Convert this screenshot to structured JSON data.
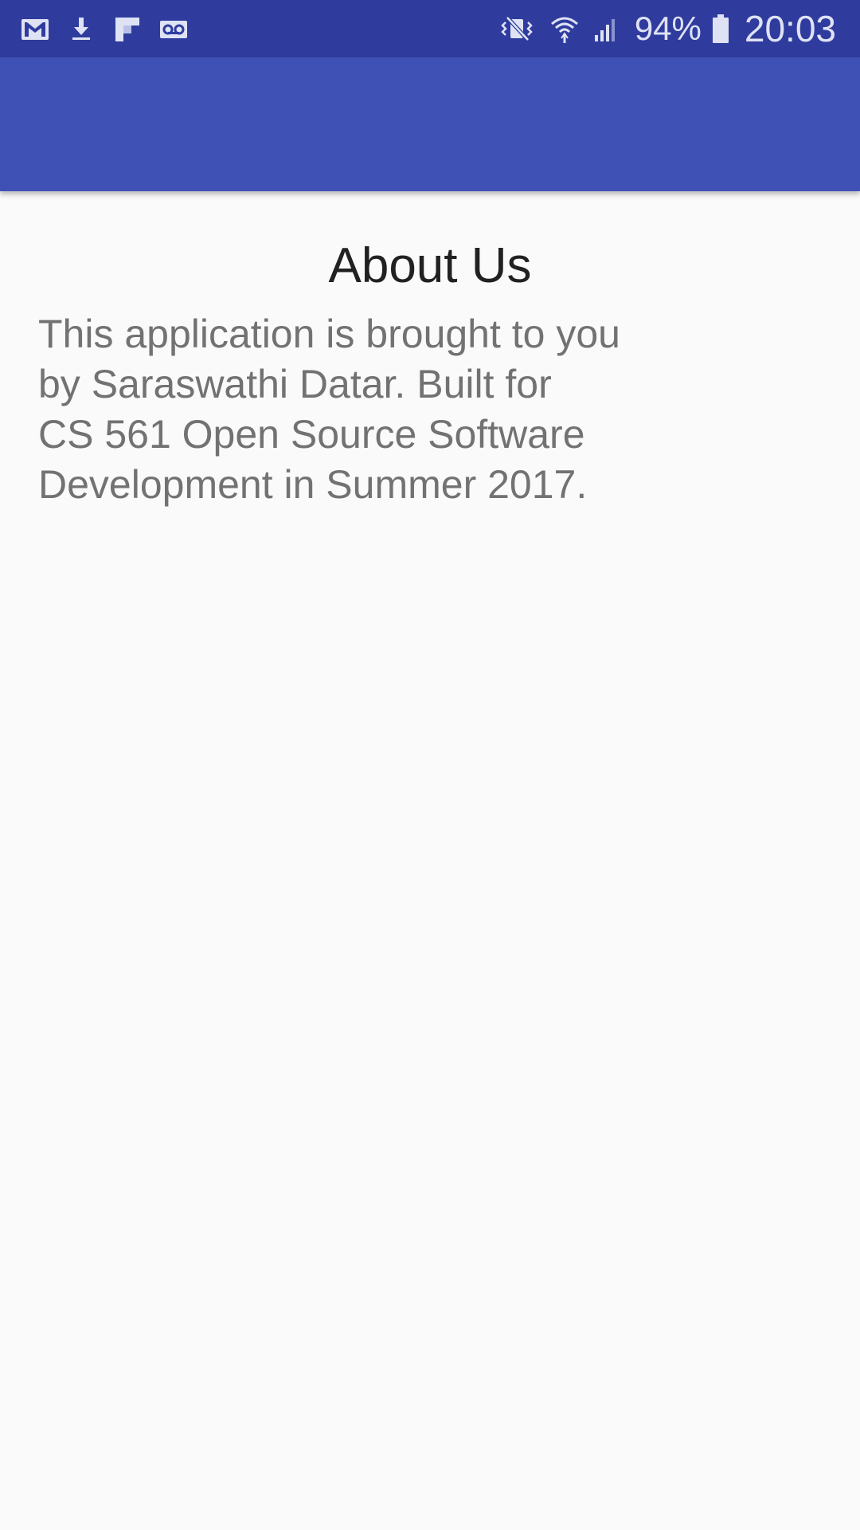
{
  "status_bar": {
    "left_icons": [
      "gmail-icon",
      "download-icon",
      "flipboard-icon",
      "voicemail-icon"
    ],
    "right_icons": [
      "vibrate-mute-icon",
      "wifi-icon",
      "cell-signal-icon",
      "battery-icon"
    ],
    "battery_percent": "94%",
    "time": "20:03",
    "background_color": "#2f3c9e"
  },
  "app_bar": {
    "background_color": "#3f51b5"
  },
  "main": {
    "title": "About Us",
    "body": "This application is brought to you\nby Saraswathi Datar.  Built for\nCS 561 Open Source Software\nDevelopment in Summer 2017."
  }
}
